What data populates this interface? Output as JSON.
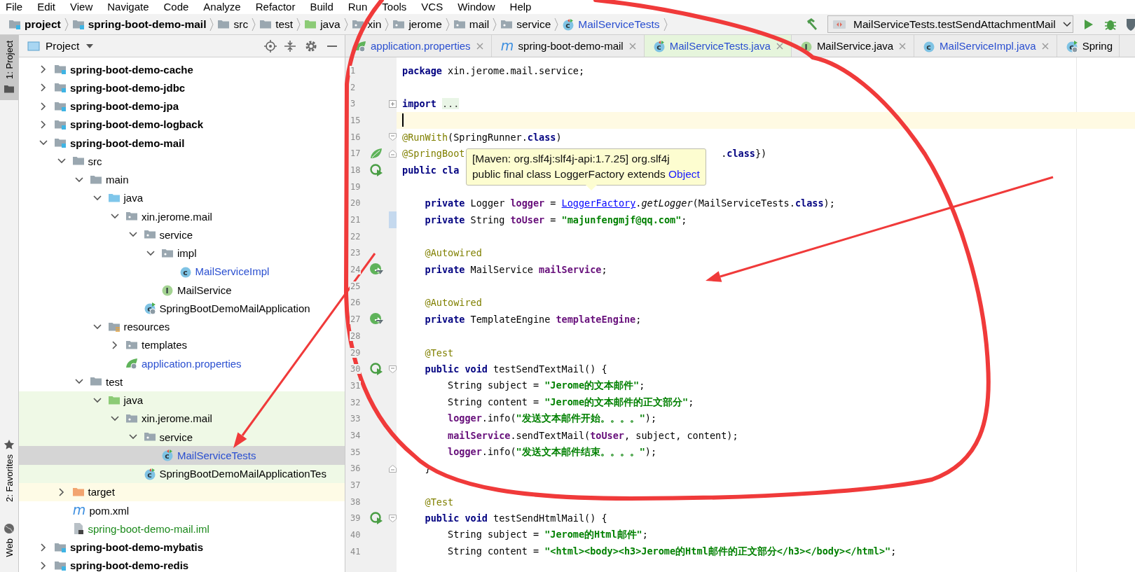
{
  "menu": [
    {
      "label": "File"
    },
    {
      "label": "Edit"
    },
    {
      "label": "View"
    },
    {
      "label": "Navigate"
    },
    {
      "label": "Code"
    },
    {
      "label": "Analyze"
    },
    {
      "label": "Refactor"
    },
    {
      "label": "Build"
    },
    {
      "label": "Run"
    },
    {
      "label": "Tools"
    },
    {
      "label": "VCS"
    },
    {
      "label": "Window"
    },
    {
      "label": "Help"
    }
  ],
  "navbar": {
    "breadcrumbs": [
      {
        "label": "project",
        "kind": "module"
      },
      {
        "label": "spring-boot-demo-mail",
        "kind": "module"
      },
      {
        "label": "src",
        "kind": "folder"
      },
      {
        "label": "test",
        "kind": "folder"
      },
      {
        "label": "java",
        "kind": "test_source"
      },
      {
        "label": "xin",
        "kind": "package"
      },
      {
        "label": "jerome",
        "kind": "package"
      },
      {
        "label": "mail",
        "kind": "package"
      },
      {
        "label": "service",
        "kind": "package"
      },
      {
        "label": "MailServiceTests",
        "kind": "test_class",
        "badge": "c",
        "color": "#2a4fd0"
      }
    ],
    "run_configuration": {
      "label": "MailServiceTests.testSendAttachmentMail"
    }
  },
  "tool_stripe": [
    {
      "label": "1: Project",
      "selected": true,
      "kind": "project"
    },
    {
      "label": "2: Favorites",
      "selected": false,
      "kind": "favorites"
    },
    {
      "label": "Web",
      "selected": false,
      "kind": "web"
    }
  ],
  "project": {
    "title": "Project",
    "tree": [
      {
        "label": "spring-boot-demo-cache",
        "kind": "module",
        "expanded": false,
        "selected": false
      },
      {
        "label": "spring-boot-demo-jdbc",
        "kind": "module",
        "expanded": false,
        "selected": false
      },
      {
        "label": "spring-boot-demo-jpa",
        "kind": "module",
        "expanded": false,
        "selected": false
      },
      {
        "label": "spring-boot-demo-logback",
        "kind": "module",
        "expanded": false,
        "selected": false
      },
      {
        "label": "spring-boot-demo-mail",
        "kind": "module",
        "expanded": true,
        "selected": false,
        "children": [
          {
            "label": "src",
            "kind": "folder",
            "expanded": true,
            "selected": false,
            "children": [
              {
                "label": "main",
                "kind": "folder",
                "expanded": true,
                "selected": false,
                "children": [
                  {
                    "label": "java",
                    "kind": "source",
                    "expanded": true,
                    "selected": false,
                    "children": [
                      {
                        "label": "xin.jerome.mail",
                        "kind": "package",
                        "expanded": true,
                        "selected": false,
                        "children": [
                          {
                            "label": "service",
                            "kind": "package",
                            "expanded": true,
                            "selected": false,
                            "children": [
                              {
                                "label": "impl",
                                "kind": "package",
                                "expanded": true,
                                "selected": false,
                                "children": [
                                  {
                                    "label": "MailServiceImpl",
                                    "kind": "class",
                                    "badge": "c",
                                    "color": "#2a4fd0",
                                    "selected": false
                                  }
                                ]
                              },
                              {
                                "label": "MailService",
                                "kind": "interface",
                                "badge": "I",
                                "selected": false
                              }
                            ]
                          },
                          {
                            "label": "SpringBootDemoMailApplication",
                            "kind": "app",
                            "badge": "c",
                            "selected": false
                          }
                        ]
                      }
                    ]
                  },
                  {
                    "label": "resources",
                    "kind": "resources",
                    "expanded": true,
                    "selected": false,
                    "children": [
                      {
                        "label": "templates",
                        "kind": "package",
                        "expanded": false,
                        "selected": false
                      },
                      {
                        "label": "application.properties",
                        "kind": "properties",
                        "color": "#2a4fd0",
                        "selected": false
                      }
                    ]
                  }
                ]
              },
              {
                "label": "test",
                "kind": "folder",
                "expanded": true,
                "selected": false,
                "children": [
                  {
                    "label": "java",
                    "kind": "test_source",
                    "expanded": true,
                    "selected": false,
                    "children": [
                      {
                        "label": "xin.jerome.mail",
                        "kind": "package",
                        "expanded": true,
                        "selected": false,
                        "children": [
                          {
                            "label": "service",
                            "kind": "package",
                            "expanded": true,
                            "selected": false,
                            "children": [
                              {
                                "label": "MailServiceTests",
                                "kind": "test_class",
                                "badge": "c",
                                "color": "#2a4fd0",
                                "selected": true
                              }
                            ]
                          },
                          {
                            "label": "SpringBootDemoMailApplicationTes",
                            "kind": "test_class",
                            "badge": "c",
                            "selected": false
                          }
                        ]
                      }
                    ]
                  }
                ]
              }
            ]
          },
          {
            "label": "target",
            "kind": "excluded",
            "expanded": false,
            "selected": false
          },
          {
            "label": "pom.xml",
            "kind": "maven",
            "badge": "m",
            "selected": false
          },
          {
            "label": "spring-boot-demo-mail.iml",
            "kind": "iml",
            "color": "#1d8a1d",
            "selected": false
          }
        ]
      },
      {
        "label": "spring-boot-demo-mybatis",
        "kind": "module",
        "expanded": false,
        "selected": false
      },
      {
        "label": "spring-boot-demo-redis",
        "kind": "module",
        "expanded": false,
        "selected": false
      }
    ]
  },
  "editor": {
    "tabs": [
      {
        "label": "application.properties",
        "kind": "properties",
        "color": "#2a4fd0",
        "selected": false,
        "closable": true
      },
      {
        "label": "spring-boot-demo-mail",
        "kind": "maven",
        "badge": "m",
        "selected": false,
        "closable": true
      },
      {
        "label": "MailServiceTests.java",
        "kind": "test_class",
        "badge": "c",
        "color": "#2a4fd0",
        "selected": true,
        "closable": true
      },
      {
        "label": "MailService.java",
        "kind": "interface",
        "badge": "I",
        "selected": false,
        "closable": true
      },
      {
        "label": "MailServiceImpl.java",
        "kind": "class",
        "badge": "c",
        "color": "#2a4fd0",
        "selected": false,
        "closable": true
      },
      {
        "label": "Spring",
        "kind": "app",
        "badge": "c",
        "selected": false,
        "closable": false
      }
    ],
    "lines": [
      {
        "number": "1",
        "current": false,
        "changed": false,
        "tokens": [
          {
            "kind": "keyword",
            "text": "package"
          },
          {
            "kind": "plain",
            "text": " xin.jerome.mail.service;"
          }
        ]
      },
      {
        "number": "2",
        "current": false,
        "changed": false
      },
      {
        "number": "3",
        "current": false,
        "changed": false,
        "fold": {
          "kind": "collapsed"
        },
        "tokens": [
          {
            "kind": "keyword",
            "text": "import"
          },
          {
            "kind": "folded",
            "text": "..."
          }
        ]
      },
      {
        "number": "15",
        "current": true,
        "changed": false
      },
      {
        "number": "16",
        "current": false,
        "changed": false,
        "fold": {
          "kind": "start"
        },
        "tokens": [
          {
            "kind": "annotation",
            "text": "@RunWith"
          },
          {
            "kind": "plain",
            "text": "(SpringRunner."
          },
          {
            "kind": "keyword",
            "text": "class"
          },
          {
            "kind": "plain",
            "text": ")"
          }
        ]
      },
      {
        "number": "17",
        "current": false,
        "changed": false,
        "gutter": {
          "kind": "spring"
        },
        "fold": {
          "kind": "end"
        },
        "tokens": [
          {
            "kind": "annotation",
            "text": "@SpringBoot"
          }
        ],
        "tokens_after_tooltip": [
          {
            "kind": "plain",
            "text": "."
          },
          {
            "kind": "keyword",
            "text": "class"
          },
          {
            "kind": "plain",
            "text": "})"
          }
        ]
      },
      {
        "number": "18",
        "current": false,
        "changed": false,
        "gutter": {
          "kind": "run"
        },
        "tokens": [
          {
            "kind": "keyword",
            "text": "public cla"
          }
        ],
        "children": [
          {
            "number": "19",
            "current": false,
            "changed": false
          },
          {
            "number": "20",
            "current": false,
            "changed": false,
            "tokens": [
              {
                "kind": "keyword",
                "text": "private"
              },
              {
                "kind": "plain",
                "text": " Logger "
              },
              {
                "kind": "field",
                "text": "logger"
              },
              {
                "kind": "plain",
                "text": " = "
              },
              {
                "kind": "link",
                "text": "LoggerFactory"
              },
              {
                "kind": "plain",
                "text": "."
              },
              {
                "kind": "static_call",
                "text": "getLogger"
              },
              {
                "kind": "plain",
                "text": "(MailServiceTests."
              },
              {
                "kind": "keyword",
                "text": "class"
              },
              {
                "kind": "plain",
                "text": ");"
              }
            ]
          },
          {
            "number": "21",
            "current": false,
            "changed": true,
            "tokens": [
              {
                "kind": "keyword",
                "text": "private"
              },
              {
                "kind": "plain",
                "text": " String "
              },
              {
                "kind": "field",
                "text": "toUser"
              },
              {
                "kind": "plain",
                "text": " = "
              },
              {
                "kind": "string",
                "text": "\"majunfengmjf@qq.com\""
              },
              {
                "kind": "plain",
                "text": ";"
              }
            ]
          },
          {
            "number": "22",
            "current": false,
            "changed": false
          },
          {
            "number": "23",
            "current": false,
            "changed": false,
            "tokens": [
              {
                "kind": "annotation",
                "text": "@Autowired"
              }
            ]
          },
          {
            "number": "24",
            "current": false,
            "changed": false,
            "gutter": {
              "kind": "bean"
            },
            "tokens": [
              {
                "kind": "keyword",
                "text": "private"
              },
              {
                "kind": "plain",
                "text": " MailService "
              },
              {
                "kind": "field",
                "text": "mailService"
              },
              {
                "kind": "plain",
                "text": ";"
              }
            ]
          },
          {
            "number": "25",
            "current": false,
            "changed": false
          },
          {
            "number": "26",
            "current": false,
            "changed": false,
            "tokens": [
              {
                "kind": "annotation",
                "text": "@Autowired"
              }
            ]
          },
          {
            "number": "27",
            "current": false,
            "changed": false,
            "gutter": {
              "kind": "bean"
            },
            "tokens": [
              {
                "kind": "keyword",
                "text": "private"
              },
              {
                "kind": "plain",
                "text": " TemplateEngine "
              },
              {
                "kind": "field",
                "text": "templateEngine"
              },
              {
                "kind": "plain",
                "text": ";"
              }
            ]
          },
          {
            "number": "28",
            "current": false,
            "changed": false
          },
          {
            "number": "29",
            "current": false,
            "changed": false,
            "tokens": [
              {
                "kind": "annotation",
                "text": "@Test"
              }
            ]
          },
          {
            "number": "30",
            "current": false,
            "changed": false,
            "gutter": {
              "kind": "run"
            },
            "fold": {
              "kind": "start"
            },
            "tokens": [
              {
                "kind": "keyword",
                "text": "public void"
              },
              {
                "kind": "plain",
                "text": " testSendTextMail() {"
              }
            ],
            "children": [
              {
                "number": "31",
                "current": false,
                "changed": false,
                "tokens": [
                  {
                    "kind": "plain",
                    "text": "String subject = "
                  },
                  {
                    "kind": "string",
                    "text": "\"Jerome的文本邮件\""
                  },
                  {
                    "kind": "plain",
                    "text": ";"
                  }
                ]
              },
              {
                "number": "32",
                "current": false,
                "changed": false,
                "tokens": [
                  {
                    "kind": "plain",
                    "text": "String content = "
                  },
                  {
                    "kind": "string",
                    "text": "\"Jerome的文本邮件的正文部分\""
                  },
                  {
                    "kind": "plain",
                    "text": ";"
                  }
                ]
              },
              {
                "number": "33",
                "current": false,
                "changed": false,
                "tokens": [
                  {
                    "kind": "field",
                    "text": "logger"
                  },
                  {
                    "kind": "plain",
                    "text": ".info("
                  },
                  {
                    "kind": "string",
                    "text": "\"发送文本邮件开始。。。。\""
                  },
                  {
                    "kind": "plain",
                    "text": ");"
                  }
                ]
              },
              {
                "number": "34",
                "current": false,
                "changed": false,
                "tokens": [
                  {
                    "kind": "field",
                    "text": "mailService"
                  },
                  {
                    "kind": "plain",
                    "text": ".sendTextMail("
                  },
                  {
                    "kind": "field",
                    "text": "toUser"
                  },
                  {
                    "kind": "plain",
                    "text": ", subject, content);"
                  }
                ]
              },
              {
                "number": "35",
                "current": false,
                "changed": false,
                "tokens": [
                  {
                    "kind": "field",
                    "text": "logger"
                  },
                  {
                    "kind": "plain",
                    "text": ".info("
                  },
                  {
                    "kind": "string",
                    "text": "\"发送文本邮件结束。。。。\""
                  },
                  {
                    "kind": "plain",
                    "text": ");"
                  }
                ]
              }
            ]
          },
          {
            "number": "36",
            "current": false,
            "changed": false,
            "fold": {
              "kind": "end"
            },
            "tokens": [
              {
                "kind": "plain",
                "text": "}"
              }
            ]
          },
          {
            "number": "37",
            "current": false,
            "changed": false
          },
          {
            "number": "38",
            "current": false,
            "changed": false,
            "tokens": [
              {
                "kind": "annotation",
                "text": "@Test"
              }
            ]
          },
          {
            "number": "39",
            "current": false,
            "changed": false,
            "gutter": {
              "kind": "run"
            },
            "fold": {
              "kind": "start"
            },
            "tokens": [
              {
                "kind": "keyword",
                "text": "public void"
              },
              {
                "kind": "plain",
                "text": " testSendHtmlMail() {"
              }
            ],
            "children": [
              {
                "number": "40",
                "current": false,
                "changed": false,
                "tokens": [
                  {
                    "kind": "plain",
                    "text": "String subject = "
                  },
                  {
                    "kind": "string",
                    "text": "\"Jerome的Html邮件\""
                  },
                  {
                    "kind": "plain",
                    "text": ";"
                  }
                ]
              },
              {
                "number": "41",
                "current": false,
                "changed": false,
                "tokens": [
                  {
                    "kind": "plain",
                    "text": "String content = "
                  },
                  {
                    "kind": "string",
                    "text": "\"<html><body><h3>Jerome的Html邮件的正文部分</h3></body></html>\""
                  },
                  {
                    "kind": "plain",
                    "text": ";"
                  }
                ]
              }
            ]
          }
        ]
      }
    ],
    "tooltip": {
      "lines": [
        {
          "text": "[Maven: org.slf4j:slf4j-api:1.7.25] org.slf4j"
        },
        {
          "text": "public final class LoggerFactory extends ",
          "link": "Object"
        }
      ]
    }
  }
}
